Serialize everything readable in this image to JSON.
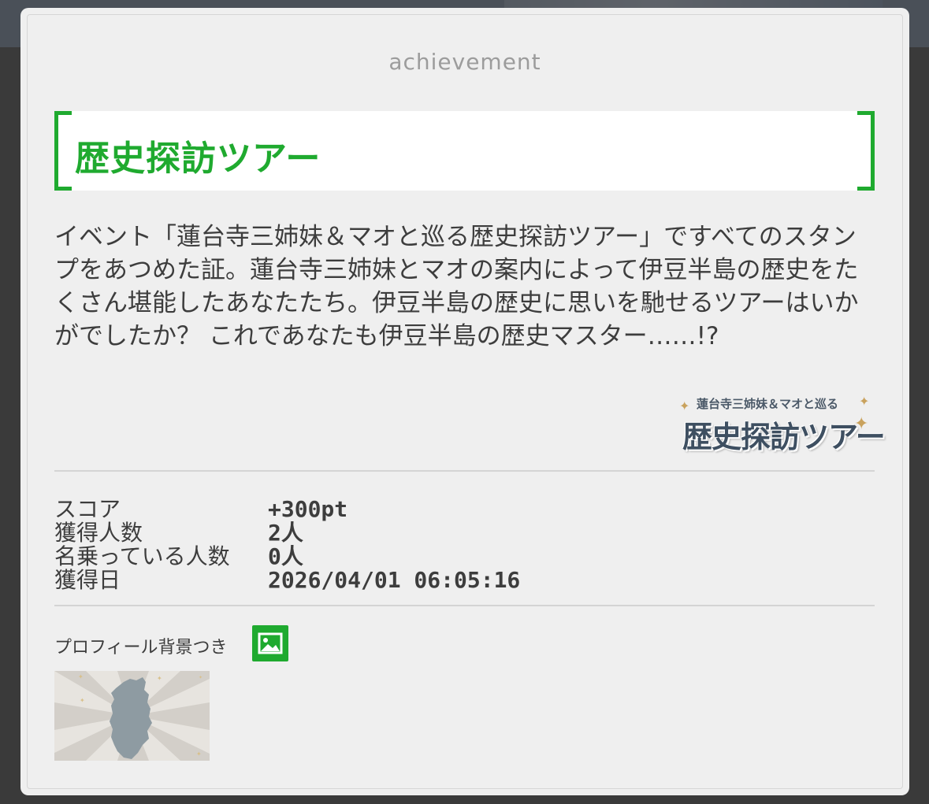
{
  "modal": {
    "type_label": "achievement",
    "title": "歴史探訪ツアー",
    "description": "イベント「蓮台寺三姉妹＆マオと巡る歴史探訪ツアー」ですべてのスタンプをあつめた証。蓮台寺三姉妹とマオの案内によって伊豆半島の歴史をたくさん堪能したあなたたち。伊豆半島の歴史に思いを馳せるツアーはいかがでしたか？ これであなたも伊豆半島の歴史マスター……!?",
    "event_logo": {
      "subtitle": "蓮台寺三姉妹＆マオと巡る",
      "title": "歴史探訪ツアー"
    }
  },
  "stats": [
    {
      "label": "スコア",
      "value": "+300pt"
    },
    {
      "label": "獲得人数",
      "value": "2人"
    },
    {
      "label": "名乗っている人数",
      "value": "0人"
    },
    {
      "label": "獲得日",
      "value": "2026/04/01 06:05:16"
    }
  ],
  "profile_background": {
    "label": "プロフィール背景つき",
    "icon": "image-icon"
  },
  "colors": {
    "accent": "#1faa2f",
    "modal_bg": "#efefef",
    "text": "#3d3d3d"
  }
}
